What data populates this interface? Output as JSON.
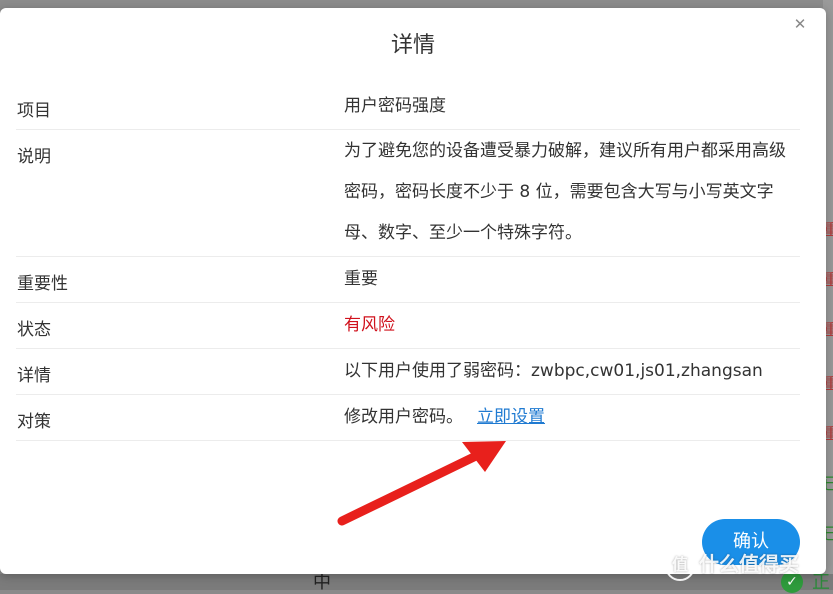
{
  "dialog": {
    "title": "详情",
    "close_icon": "close-icon",
    "confirm_label": "确认",
    "rows": [
      {
        "label": "项目",
        "value": "用户密码强度"
      },
      {
        "label": "说明",
        "value": "为了避免您的设备遭受暴力破解，建议所有用户都采用高级密码，密码长度不少于 8 位，需要包含大写与小写英文字母、数字、至少一个特殊字符。"
      },
      {
        "label": "重要性",
        "value": "重要"
      },
      {
        "label": "状态",
        "value": "有风险"
      },
      {
        "label": "详情",
        "value": "以下用户使用了弱密码：zwbpc,cw01,js01,zhangsan"
      },
      {
        "label": "对策",
        "value": "修改用户密码。",
        "link": "立即设置"
      }
    ]
  },
  "background": {
    "bottom_text": "中",
    "check_label": "正",
    "right_glyphs": [
      "重",
      "重",
      "重",
      "重",
      "重",
      "已",
      "已"
    ]
  },
  "watermark": {
    "badge": "值",
    "text": "什么值得买"
  },
  "colors": {
    "risk": "#d0111c",
    "link": "#1f7ad1",
    "confirm": "#1a8fe8",
    "annotation_arrow": "#e8201c"
  }
}
